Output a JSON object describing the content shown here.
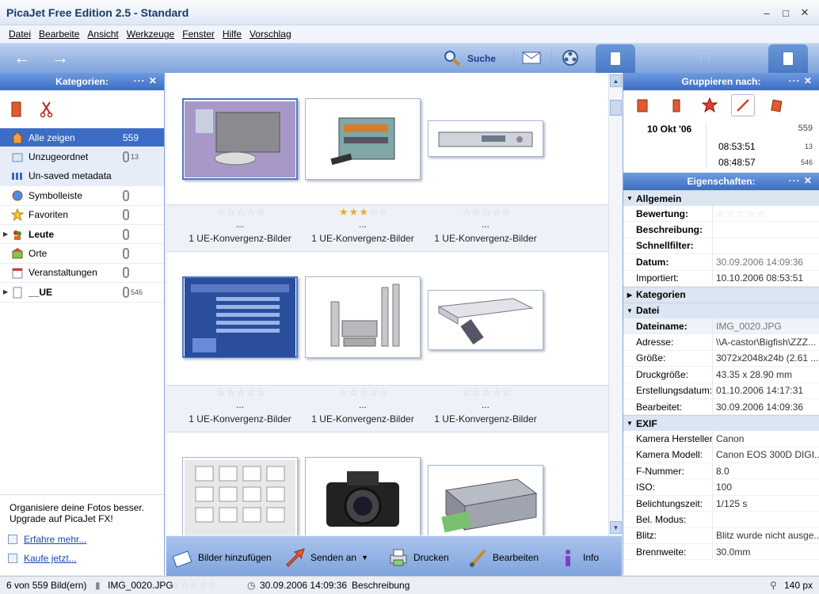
{
  "window": {
    "title": "PicaJet Free Edition 2.5  - Standard"
  },
  "menu": [
    "Datei",
    "Bearbeite",
    "Ansicht",
    "Werkzeuge",
    "Fenster",
    "Hilfe",
    "Vorschlag"
  ],
  "toolbar": {
    "search_label": "Suche"
  },
  "categories": {
    "header": "Kategorien:",
    "items": [
      {
        "label": "Alle zeigen",
        "count": "559"
      },
      {
        "label": "Unzugeordnet",
        "count": "13"
      },
      {
        "label": "Un-saved metadata",
        "count": ""
      },
      {
        "label": "Symbolleiste",
        "count": ""
      },
      {
        "label": "Favoriten",
        "count": ""
      },
      {
        "label": "Leute",
        "count": ""
      },
      {
        "label": "Orte",
        "count": ""
      },
      {
        "label": "Veranstaltungen",
        "count": ""
      },
      {
        "label": "__UE",
        "count": "546"
      }
    ],
    "promo_text": "Organisiere deine Fotos besser. Upgrade auf PicaJet FX!",
    "link_more": "Erfahre mehr...",
    "link_buy": "Kaufe jetzt..."
  },
  "gallery": {
    "caption": "1 UE-Konvergenz-Bilder",
    "dots": "...",
    "rows": [
      {
        "ratings": [
          0,
          2.5,
          0
        ]
      },
      {
        "ratings": [
          0,
          0,
          0
        ]
      },
      {
        "ratings": [
          0,
          0,
          0
        ]
      }
    ]
  },
  "actions": {
    "add": "Bilder hinzufügen",
    "send": "Senden an",
    "print": "Drucken",
    "edit": "Bearbeiten",
    "info": "Info"
  },
  "group": {
    "header": "Gruppieren nach:",
    "date": "10 Okt  '06",
    "date_count": "559",
    "times": [
      {
        "time": "08:53:51",
        "count": "13"
      },
      {
        "time": "08:48:57",
        "count": "546"
      }
    ]
  },
  "properties": {
    "header": "Eigenschaften:",
    "sec_general": "Allgemein",
    "rating_label": "Bewertung:",
    "description_label": "Beschreibung:",
    "quickfilter_label": "Schnellfilter:",
    "date_label": "Datum:",
    "date_value": "30.09.2006 14:09:36",
    "imported_label": "Importiert:",
    "imported_value": "10.10.2006 08:53:51",
    "sec_categories": "Kategorien",
    "sec_file": "Datei",
    "filename_label": "Dateiname:",
    "filename_value": "IMG_0020.JPG",
    "address_label": "Adresse:",
    "address_value": "\\\\A-castor\\Bigfish\\ZZZ...",
    "size_label": "Größe:",
    "size_value": "3072x2048x24b (2.61 ...",
    "printsize_label": "Druckgröße:",
    "printsize_value": "43.35 x 28.90 mm",
    "created_label": "Erstellungsdatum:",
    "created_value": "01.10.2006 14:17:31",
    "edited_label": "Bearbeitet:",
    "edited_value": "30.09.2006 14:09:36",
    "sec_exif": "EXIF",
    "maker_label": "Kamera Hersteller:",
    "maker_value": "Canon",
    "model_label": "Kamera Modell:",
    "model_value": "Canon EOS 300D DIGI...",
    "fnumber_label": "F-Nummer:",
    "fnumber_value": "8.0",
    "iso_label": "ISO:",
    "iso_value": "100",
    "exposure_label": "Belichtungszeit:",
    "exposure_value": "1/125 s",
    "expmode_label": "Bel. Modus:",
    "expmode_value": "",
    "flash_label": "Blitz:",
    "flash_value": "Blitz wurde nicht ausge...",
    "focal_label": "Brennweite:",
    "focal_value": "30.0mm"
  },
  "status": {
    "count": "6 von 559 Bild(ern)",
    "filename": "IMG_0020.JPG",
    "datetime": "30.09.2006 14:09:36",
    "desc": "Beschreibung",
    "zoom": "140 px"
  },
  "colors": {
    "accent": "#3c6cc5",
    "toolbar": "#7ea3dc"
  }
}
